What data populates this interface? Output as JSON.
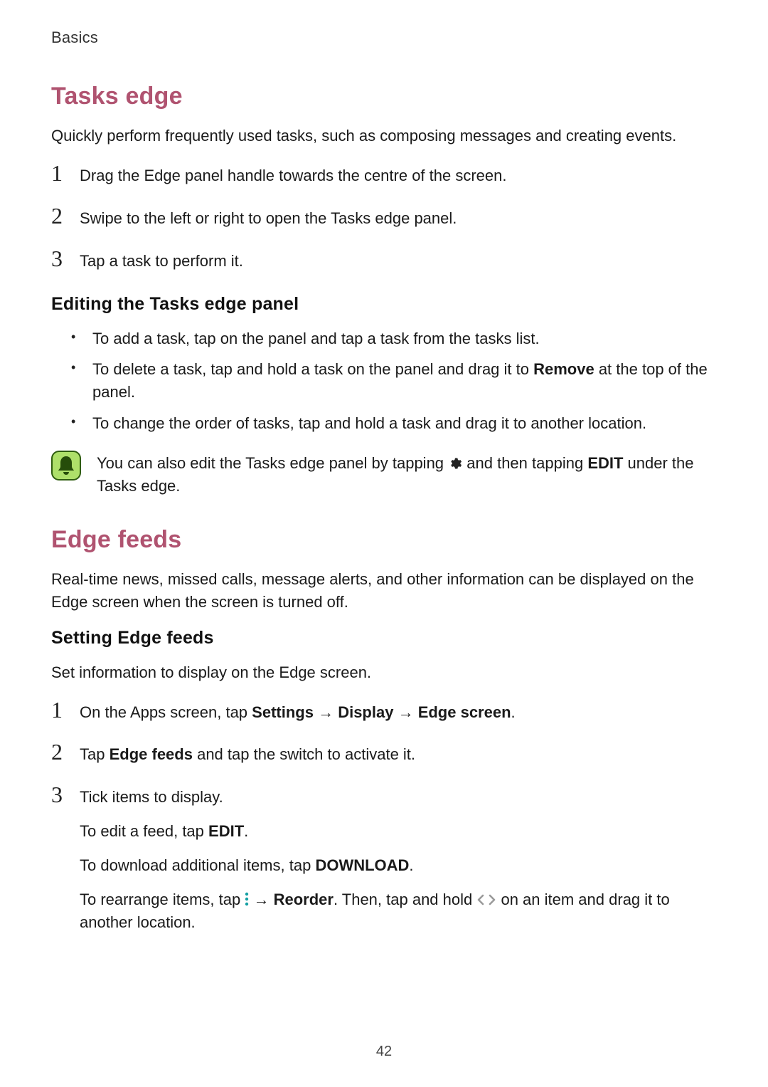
{
  "header": "Basics",
  "page_number": "42",
  "tasks": {
    "title": "Tasks edge",
    "intro": "Quickly perform frequently used tasks, such as composing messages and creating events.",
    "steps": [
      {
        "n": "1",
        "text": "Drag the Edge panel handle towards the centre of the screen."
      },
      {
        "n": "2",
        "text": "Swipe to the left or right to open the Tasks edge panel."
      },
      {
        "n": "3",
        "text": "Tap a task to perform it."
      }
    ],
    "edit_title": "Editing the Tasks edge panel",
    "bullets": {
      "add": "To add a task, tap  on the panel and tap a task from the tasks list.",
      "delete_pre": "To delete a task, tap and hold a task on the panel and drag it to ",
      "delete_bold": "Remove",
      "delete_post": " at the top of the panel.",
      "reorder": "To change the order of tasks, tap and hold a task and drag it to another location."
    },
    "tip": {
      "pre": "You can also edit the Tasks edge panel by tapping ",
      "mid": " and then tapping ",
      "bold": "EDIT",
      "post": " under the Tasks edge."
    }
  },
  "feeds": {
    "title": "Edge feeds",
    "intro": "Real-time news, missed calls, message alerts, and other information can be displayed on the Edge screen when the screen is turned off.",
    "sub_title": "Setting Edge feeds",
    "sub_intro": "Set information to display on the Edge screen.",
    "steps": [
      {
        "n": "1",
        "pre": "On the Apps screen, tap ",
        "b1": "Settings",
        "arrow1": " → ",
        "b2": "Display",
        "arrow2": " → ",
        "b3": "Edge screen",
        "post": "."
      },
      {
        "n": "2",
        "pre": "Tap ",
        "b1": "Edge feeds",
        "post": " and tap the switch to activate it."
      },
      {
        "n": "3",
        "text": "Tick items to display.",
        "sub1_pre": "To edit a feed, tap ",
        "sub1_bold": "EDIT",
        "sub1_post": ".",
        "sub2_pre": "To download additional items, tap ",
        "sub2_bold": "DOWNLOAD",
        "sub2_post": ".",
        "sub3_pre": "To rearrange items, tap ",
        "sub3_arrow": " → ",
        "sub3_bold": "Reorder",
        "sub3_mid": ". Then, tap and hold ",
        "sub3_post": " on an item and drag it to another location."
      }
    ]
  }
}
